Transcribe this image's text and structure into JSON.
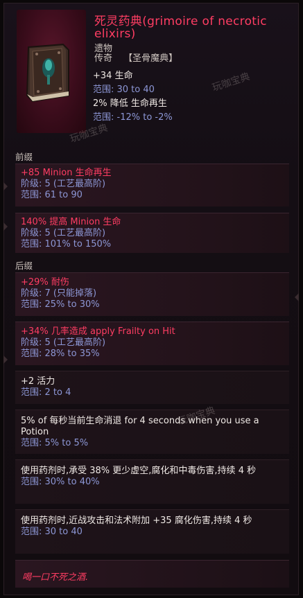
{
  "item": {
    "name": "死灵药典(grimoire of necrotic elixirs)",
    "type": "遗物",
    "rarity": "传奇",
    "base": "【圣骨魔典】",
    "implicits": [
      {
        "stat": "+34 生命",
        "range": "范围: 30 to 40"
      },
      {
        "stat": "2% 降低 生命再生",
        "range": "范围: -12% to -2%"
      }
    ]
  },
  "watermarks": [
    "玩咖宝典",
    "玩咖宝典",
    "玩咖宝典"
  ],
  "prefix_label": "前缀",
  "prefixes": [
    {
      "stat": "+85 Minion 生命再生",
      "tier": "阶级: 5 (工艺最高阶)",
      "range": "范围: 61 to 90"
    },
    {
      "stat": "140% 提高 Minion 生命",
      "tier": "阶级: 5 (工艺最高阶)",
      "range": "范围: 101% to 150%"
    }
  ],
  "suffix_label": "后缀",
  "suffixes": [
    {
      "stat": "+29% 耐伤",
      "tier": "阶级: 7 (只能掉落)",
      "range": "范围: 25% to 30%"
    },
    {
      "stat": "+34% 几率造成 apply Frailty on Hit",
      "tier": "阶级: 5 (工艺最高阶)",
      "range": "范围: 28% to 35%"
    }
  ],
  "uniques": [
    {
      "stat": "+2 活力",
      "range": "范围: 2 to 4"
    },
    {
      "stat": "5% of 每秒当前生命消退 for 4 seconds when you use a Potion",
      "range": "范围: 5% to 5%"
    },
    {
      "stat": "使用药剂时,承受 38% 更少虚空,腐化和中毒伤害,持续 4 秒",
      "range": "范围: 30% to 40%"
    },
    {
      "stat": "使用药剂时,近战攻击和法术附加 +35 腐化伤害,持续 4 秒",
      "range": "范围: 30 to 40"
    }
  ],
  "flavor": "喝一口不死之酒.",
  "colors": {
    "affix_red": "#ff3d63",
    "range_blue": "#8d97d6",
    "name_red": "#ff3d63"
  }
}
